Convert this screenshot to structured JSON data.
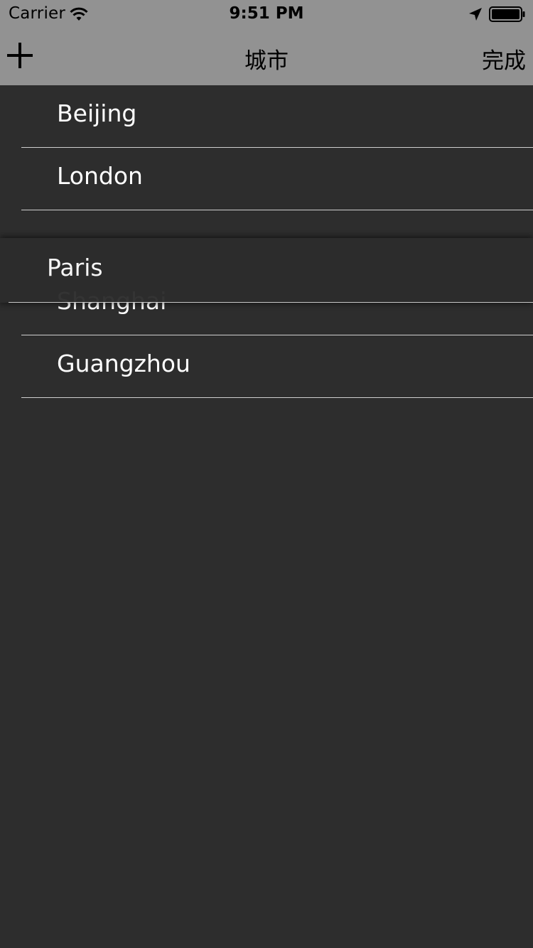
{
  "status_bar": {
    "carrier": "Carrier",
    "time": "9:51 PM",
    "icons": [
      "wifi-icon",
      "location-arrow-icon",
      "battery-icon"
    ]
  },
  "nav_bar": {
    "title": "城市",
    "left_icon": "plus-icon",
    "right_label": "完成"
  },
  "cities": [
    "Beijing",
    "London",
    "Shanghai",
    "Guangzhou"
  ],
  "dragged_city": "Paris",
  "colors": {
    "header_background": "#929292",
    "list_background": "#2d2d2d",
    "separator": "#cfcfcf",
    "text": "#ffffff"
  }
}
